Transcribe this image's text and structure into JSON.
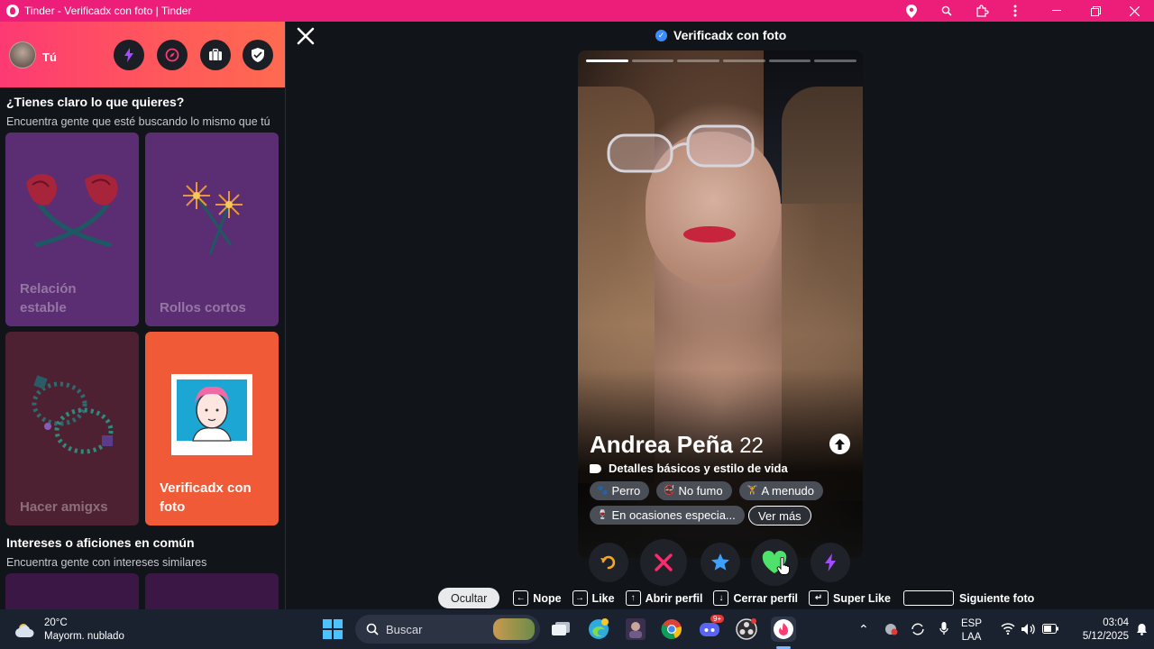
{
  "window": {
    "title": "Tinder - Verificadx con foto | Tinder",
    "icons": [
      "location-icon",
      "zoom-icon",
      "extensions-icon",
      "more-icon",
      "minimize-icon",
      "restore-icon",
      "close-icon"
    ]
  },
  "sidebar": {
    "user_label": "Tú",
    "header_buttons": [
      "boost-icon",
      "explore-icon",
      "briefcase-icon",
      "shield-icon"
    ],
    "section1": {
      "title": "¿Tienes claro lo que quieres?",
      "subtitle": "Encuentra gente que esté buscando lo mismo que tú"
    },
    "cards": [
      {
        "label": "Relación estable",
        "color": "#5b2d72"
      },
      {
        "label": "Rollos cortos",
        "color": "#5b2d72"
      },
      {
        "label": "Hacer amigxs",
        "color": "#4e2132"
      },
      {
        "label": "Verificadx con foto",
        "color": "#f05a36"
      }
    ],
    "section2": {
      "title": "Intereses o aficiones en común",
      "subtitle": "Encuentra gente con intereses similares"
    }
  },
  "main": {
    "header_title": "Verificadx con foto",
    "photo_count": 6,
    "photo_active": 0,
    "profile": {
      "name": "Andrea Peña",
      "age": "22",
      "details_label": "Detalles básicos y estilo de vida",
      "chips": [
        "Perro",
        "No fumo",
        "A menudo",
        "En ocasiones especia..."
      ],
      "see_more": "Ver más"
    },
    "actions": [
      "rewind-icon",
      "nope-icon",
      "super-like-icon",
      "like-icon",
      "boost-icon"
    ]
  },
  "shortcuts": {
    "hide": "Ocultar",
    "items": [
      {
        "key": "←",
        "label": "Nope"
      },
      {
        "key": "→",
        "label": "Like"
      },
      {
        "key": "↑",
        "label": "Abrir perfil"
      },
      {
        "key": "↓",
        "label": "Cerrar perfil"
      },
      {
        "key": "↵",
        "label": "Super Like"
      },
      {
        "key": " ",
        "label": "Siguiente foto"
      }
    ]
  },
  "taskbar": {
    "temp": "20°C",
    "weather": "Mayorm. nublado",
    "search_placeholder": "Buscar",
    "lang": "ESP",
    "layout": "LAA",
    "time": "03:04",
    "date": "5/12/2025",
    "badge": "9+"
  }
}
